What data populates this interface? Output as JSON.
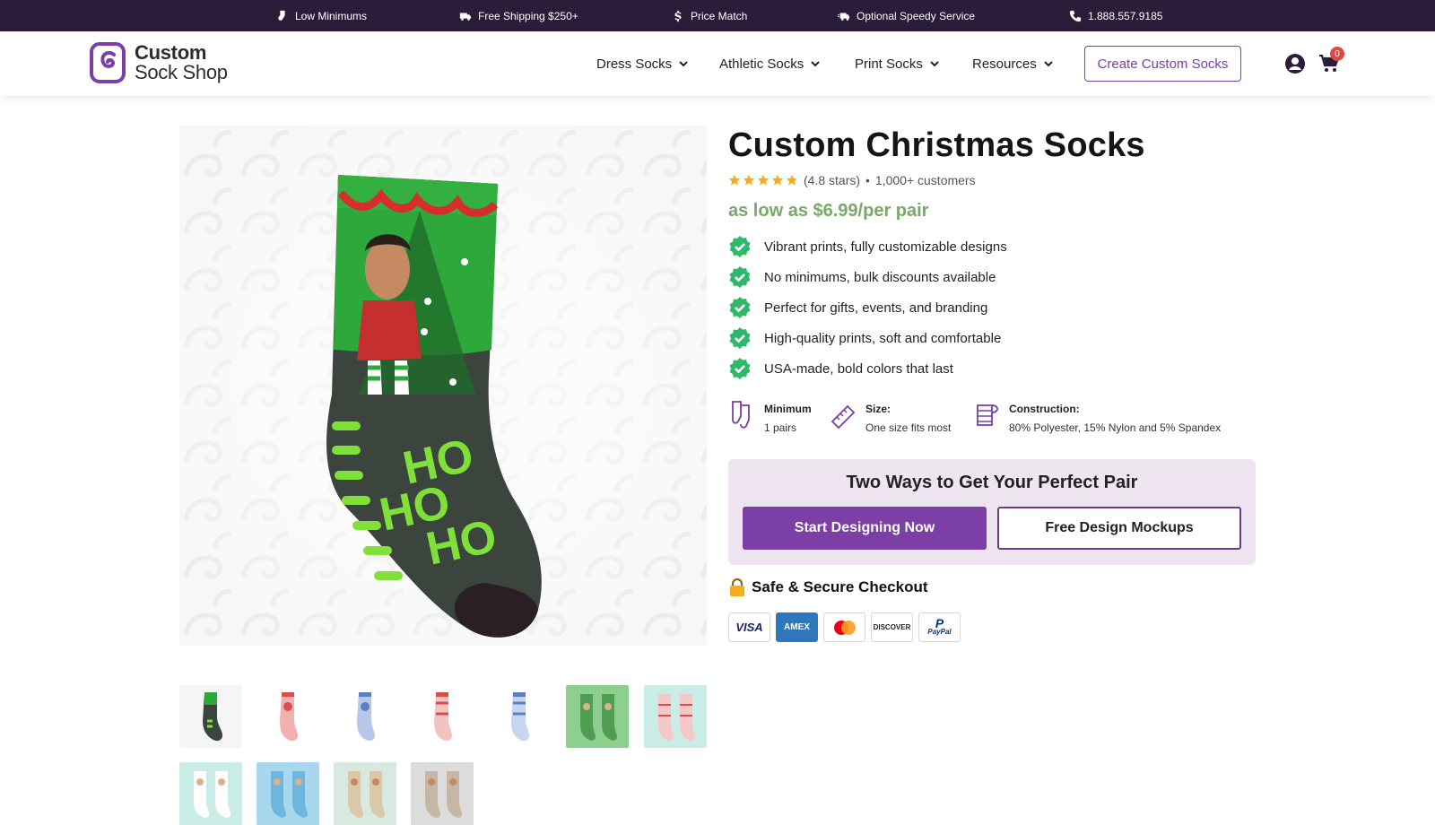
{
  "topbar": {
    "items": [
      {
        "icon": "sock-icon",
        "label": "Low Minimums"
      },
      {
        "icon": "truck-icon",
        "label": "Free Shipping $250+"
      },
      {
        "icon": "dollar-icon",
        "label": "Price Match"
      },
      {
        "icon": "fast-truck-icon",
        "label": "Optional Speedy Service"
      },
      {
        "icon": "phone-icon",
        "label": "1.888.557.9185"
      }
    ]
  },
  "header": {
    "logo": {
      "line1": "Custom",
      "line2": "Sock Shop"
    },
    "nav": [
      {
        "label": "Dress Socks"
      },
      {
        "label": "Athletic Socks"
      },
      {
        "label": "Print Socks"
      },
      {
        "label": "Resources"
      }
    ],
    "cta": "Create Custom Socks",
    "cart_count": "0"
  },
  "product": {
    "title": "Custom Christmas Socks",
    "rating_text": "(4.8 stars)",
    "customers_text": "1,000+ customers",
    "rating_value": 4.8,
    "price_text": "as low as $6.99/per pair",
    "features": [
      "Vibrant prints, fully customizable designs",
      "No minimums, bulk discounts available",
      "Perfect for gifts, events, and branding",
      "High-quality prints, soft and comfortable",
      "USA-made, bold colors that last"
    ],
    "specs": [
      {
        "label": "Minimum",
        "value": "1 pairs"
      },
      {
        "label": "Size:",
        "value": "One size fits most"
      },
      {
        "label": "Construction:",
        "value": "80% Polyester, 15% Nylon and 5% Spandex"
      }
    ],
    "hero_sock_text": "HO HO HO"
  },
  "cta_box": {
    "title": "Two Ways to Get Your Perfect Pair",
    "primary": "Start Designing Now",
    "secondary": "Free Design Mockups"
  },
  "checkout": {
    "title": "Safe & Secure Checkout",
    "lock_emoji": "🔒",
    "cards": [
      "VISA",
      "AMEX",
      "mastercard",
      "DISCOVER",
      "PayPal"
    ]
  },
  "thumbnails": [
    {
      "icon": "green-elf-sock-thumb"
    },
    {
      "icon": "red-sock-thumb"
    },
    {
      "icon": "blue-sock-thumb"
    },
    {
      "icon": "red-sock-thumb"
    },
    {
      "icon": "blue-sock-thumb"
    },
    {
      "icon": "green-pair-thumb"
    },
    {
      "icon": "pink-pair-thumb"
    },
    {
      "icon": "mint-pair-thumb"
    },
    {
      "icon": "blue-pair-thumb"
    },
    {
      "icon": "beige-pair-thumb"
    },
    {
      "icon": "grey-pair-thumb"
    }
  ],
  "colors": {
    "topbar_bg": "#2b1d3a",
    "brand_purple": "#7b3fa6",
    "price_green": "#78a86a",
    "check_green": "#2fb86a",
    "star_gold": "#f2b01e",
    "cta_box_bg": "#eee5f1"
  }
}
